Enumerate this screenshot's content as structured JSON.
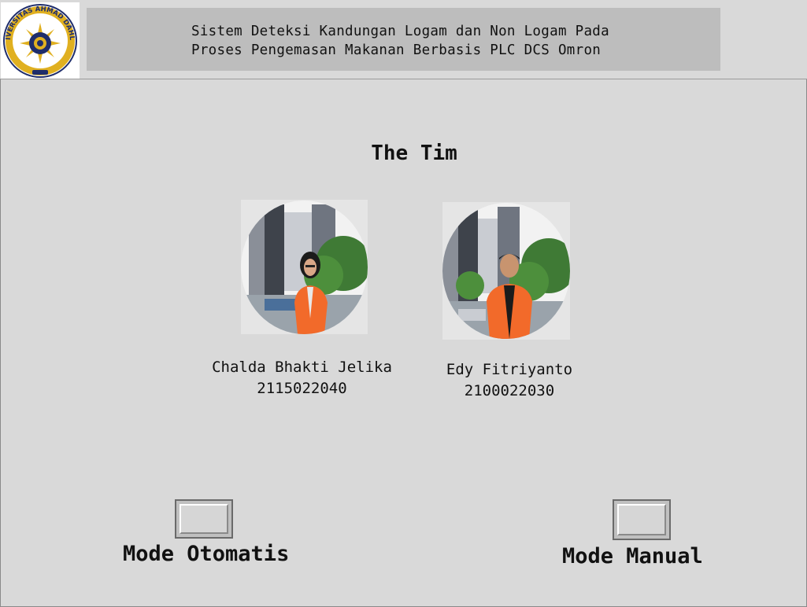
{
  "header": {
    "logo_alt": "UNIVERSITAS AHMAD DAHLAN",
    "title_line1": "Sistem Deteksi Kandungan Logam dan Non Logam Pada",
    "title_line2": "Proses Pengemasan Makanan Berbasis PLC DCS Omron"
  },
  "team": {
    "heading": "The Tim",
    "members": [
      {
        "name": "Chalda Bhakti Jelika",
        "id": "2115022040"
      },
      {
        "name": "Edy Fitriyanto",
        "id": "2100022030"
      }
    ]
  },
  "modes": {
    "auto_label": "Mode Otomatis",
    "manual_label": "Mode Manual"
  },
  "colors": {
    "background": "#d9d9d9",
    "title_box": "#bdbdbd",
    "jacket": "#f26a2a",
    "logo_ring": "#1f2d6b",
    "logo_gold": "#e0b020"
  }
}
